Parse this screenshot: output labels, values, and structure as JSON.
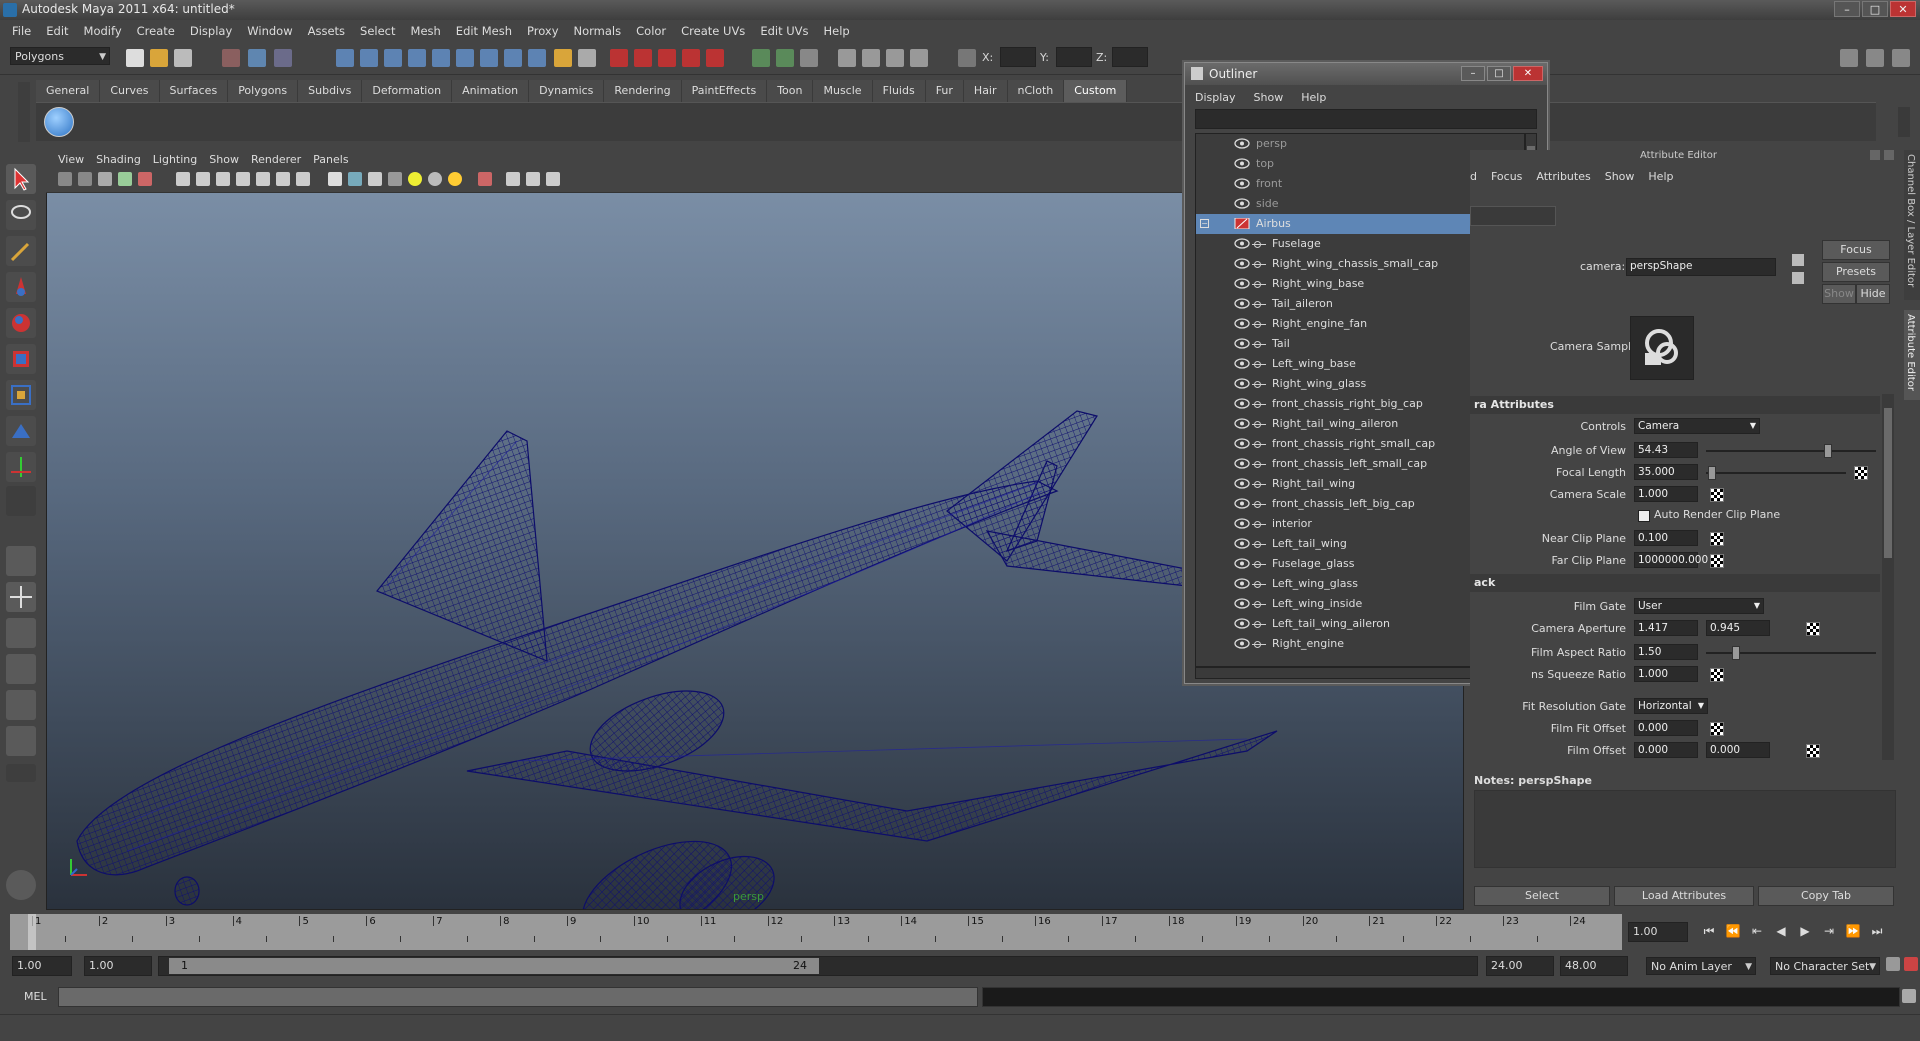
{
  "window": {
    "title": "Autodesk Maya 2011 x64: untitled*"
  },
  "menubar": [
    "File",
    "Edit",
    "Modify",
    "Create",
    "Display",
    "Window",
    "Assets",
    "Select",
    "Mesh",
    "Edit Mesh",
    "Proxy",
    "Normals",
    "Color",
    "Create UVs",
    "Edit UVs",
    "Help"
  ],
  "statusline": {
    "mode": "Polygons",
    "x_label": "X:",
    "y_label": "Y:",
    "z_label": "Z:"
  },
  "shelf_tabs": [
    "General",
    "Curves",
    "Surfaces",
    "Polygons",
    "Subdivs",
    "Deformation",
    "Animation",
    "Dynamics",
    "Rendering",
    "PaintEffects",
    "Toon",
    "Muscle",
    "Fluids",
    "Fur",
    "Hair",
    "nCloth",
    "Custom"
  ],
  "shelf_active": "Custom",
  "viewport": {
    "menu": [
      "View",
      "Shading",
      "Lighting",
      "Show",
      "Renderer",
      "Panels"
    ],
    "camera_label": "persp"
  },
  "outliner": {
    "title": "Outliner",
    "menu": [
      "Display",
      "Show",
      "Help"
    ],
    "items": [
      {
        "label": "persp",
        "dim": true
      },
      {
        "label": "top",
        "dim": true
      },
      {
        "label": "front",
        "dim": true
      },
      {
        "label": "side",
        "dim": true
      },
      {
        "label": "Airbus",
        "selected": true
      },
      {
        "label": "Fuselage"
      },
      {
        "label": "Right_wing_chassis_small_cap"
      },
      {
        "label": "Right_wing_base"
      },
      {
        "label": "Tail_aileron"
      },
      {
        "label": "Right_engine_fan"
      },
      {
        "label": "Tail"
      },
      {
        "label": "Left_wing_base"
      },
      {
        "label": "Right_wing_glass"
      },
      {
        "label": "front_chassis_right_big_cap"
      },
      {
        "label": "Right_tail_wing_aileron"
      },
      {
        "label": "front_chassis_right_small_cap"
      },
      {
        "label": "front_chassis_left_small_cap"
      },
      {
        "label": "Right_tail_wing"
      },
      {
        "label": "front_chassis_left_big_cap"
      },
      {
        "label": "interior"
      },
      {
        "label": "Left_tail_wing"
      },
      {
        "label": "Fuselage_glass"
      },
      {
        "label": "Left_wing_glass"
      },
      {
        "label": "Left_wing_inside"
      },
      {
        "label": "Left_tail_wing_aileron"
      },
      {
        "label": "Right_engine"
      }
    ]
  },
  "attribute_editor": {
    "title": "Attribute Editor",
    "side_tabs": [
      "Channel Box / Layer Editor",
      "Attribute Editor"
    ],
    "menu": [
      "d",
      "Focus",
      "Attributes",
      "Show",
      "Help"
    ],
    "camera_label": "camera:",
    "camera_value": "perspShape",
    "focus_button": "Focus",
    "presets_button": "Presets",
    "show_button": "Show",
    "hide_button": "Hide",
    "sample_label": "Camera Sample",
    "section_camera": "ra Attributes",
    "section_film": "ack",
    "fields": {
      "controls_label": "Controls",
      "controls_value": "Camera",
      "aov_label": "Angle of View",
      "aov_value": "54.43",
      "focal_label": "Focal Length",
      "focal_value": "35.000",
      "scale_label": "Camera Scale",
      "scale_value": "1.000",
      "auto_clip_label": "Auto Render Clip Plane",
      "near_label": "Near Clip Plane",
      "near_value": "0.100",
      "far_label": "Far Clip Plane",
      "far_value": "1000000.000",
      "filmgate_label": "Film Gate",
      "filmgate_value": "User",
      "aperture_label": "Camera Aperture",
      "aperture_value_1": "1.417",
      "aperture_value_2": "0.945",
      "film_aspect_label": "Film Aspect Ratio",
      "film_aspect_value": "1.50",
      "squeeze_label": "ns Squeeze Ratio",
      "squeeze_value": "1.000",
      "fitres_label": "Fit Resolution Gate",
      "fitres_value": "Horizontal",
      "fitoffset_label": "Film Fit Offset",
      "fitoffset_value": "0.000",
      "filmoffset_label": "Film Offset",
      "filmoffset_value_1": "0.000",
      "filmoffset_value_2": "0.000"
    },
    "notes_label": "Notes:  perspShape",
    "bottom_buttons": [
      "Select",
      "Load Attributes",
      "Copy Tab"
    ]
  },
  "timeline": {
    "ticks": [
      "1",
      "2",
      "3",
      "4",
      "5",
      "6",
      "7",
      "8",
      "9",
      "10",
      "11",
      "12",
      "13",
      "14",
      "15",
      "16",
      "17",
      "18",
      "19",
      "20",
      "21",
      "22",
      "23",
      "24"
    ],
    "current_frame": "1.00"
  },
  "range": {
    "start": "1.00",
    "anim_start": "1.00",
    "slider_start": "1",
    "slider_end": "24",
    "end": "24.00",
    "anim_end": "48.00",
    "anim_layer": "No Anim Layer",
    "char_set": "No Character Set"
  },
  "cmdline": {
    "label": "MEL"
  },
  "colors": {
    "selection": "#5e86b6",
    "wireframe": "#1a1a7a",
    "panel": "#444444"
  }
}
